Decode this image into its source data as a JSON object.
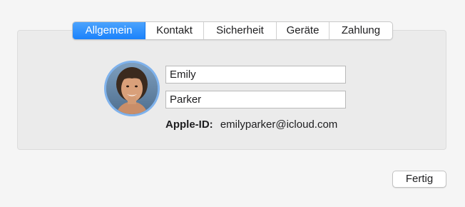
{
  "tabs": [
    {
      "label": "Allgemein",
      "active": true
    },
    {
      "label": "Kontakt",
      "active": false
    },
    {
      "label": "Sicherheit",
      "active": false
    },
    {
      "label": "Geräte",
      "active": false
    },
    {
      "label": "Zahlung",
      "active": false
    }
  ],
  "profile": {
    "avatar_icon": "user-photo",
    "first_name": "Emily",
    "last_name": "Parker",
    "apple_id_label": "Apple-ID:",
    "apple_id_value": "emilyparker@icloud.com"
  },
  "footer": {
    "done_label": "Fertig"
  },
  "colors": {
    "accent": "#1a82fb",
    "avatar_ring": "#7fb2ec",
    "panel": "#ebebeb",
    "window": "#f5f5f5"
  }
}
